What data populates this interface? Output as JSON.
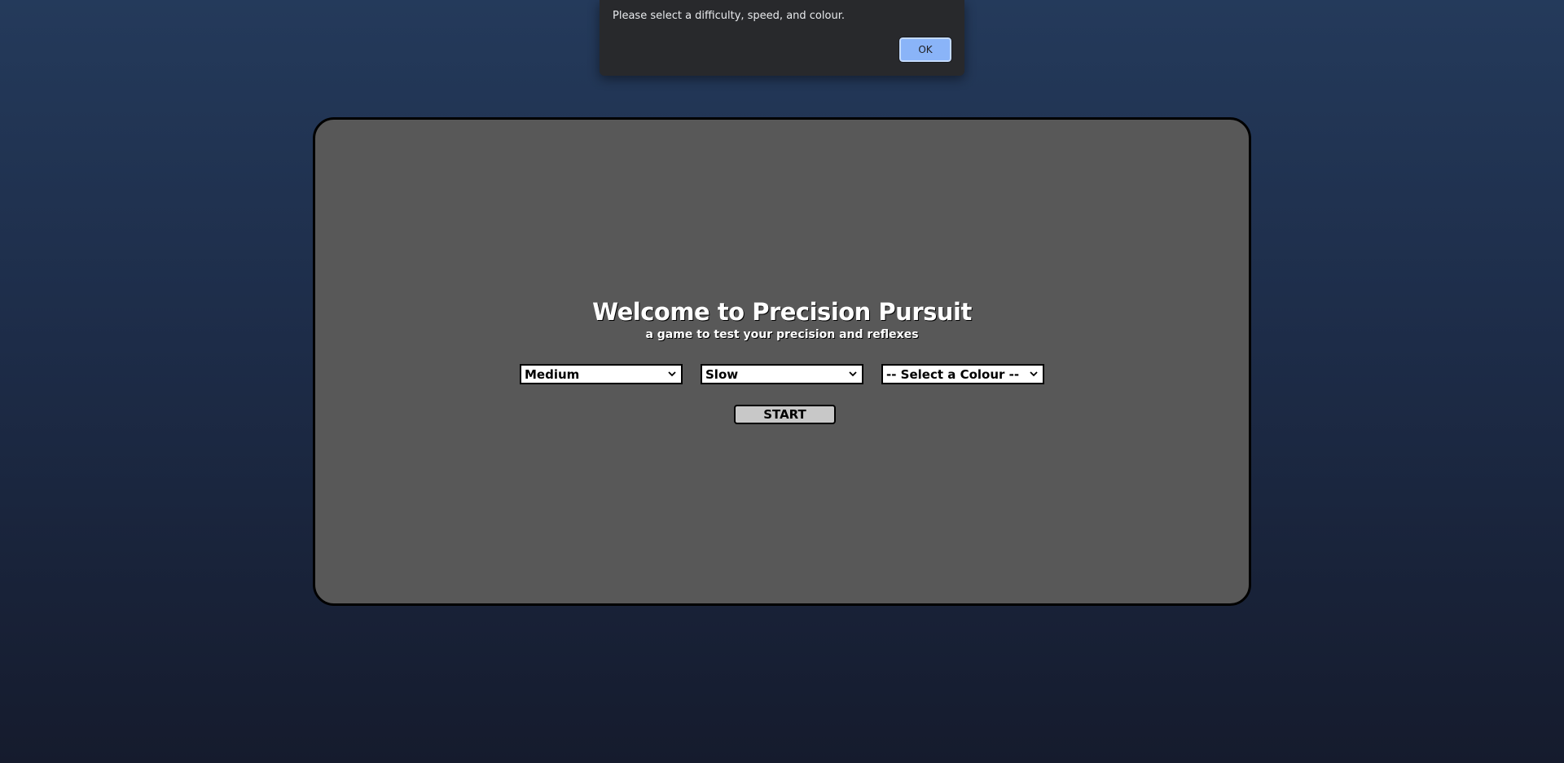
{
  "alert": {
    "message": "Please select a difficulty, speed, and colour.",
    "ok_label": "OK"
  },
  "game": {
    "title": "Welcome to Precision Pursuit",
    "subtitle": "a game to test your precision and reflexes",
    "difficulty_select": {
      "value": "Medium"
    },
    "speed_select": {
      "value": "Slow"
    },
    "colour_select": {
      "value": "-- Select a Colour --"
    },
    "start_label": "START"
  },
  "colors": {
    "background_top": "#243a5b",
    "background_bottom": "#151b2d",
    "panel": "#585858",
    "alert_bg": "#28292c",
    "ok_button": "#8ab4f8",
    "start_button": "#c8c8c8"
  },
  "icons": {
    "select_arrow": "chevron-down-icon"
  }
}
